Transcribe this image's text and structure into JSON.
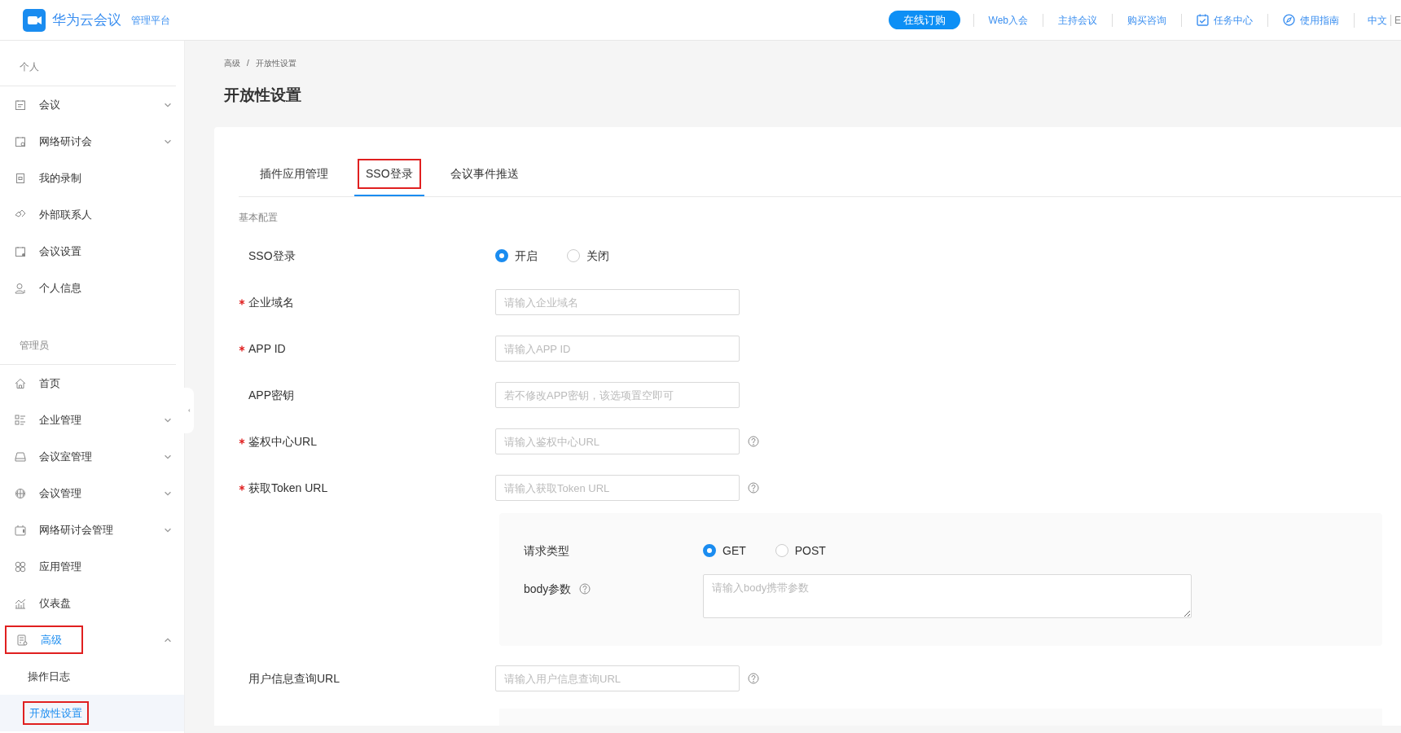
{
  "header": {
    "logo_text": "华为云会议",
    "sub_text": "管理平台",
    "buy_button": "在线订购",
    "links": [
      {
        "label": "Web入会",
        "kind": "text"
      },
      {
        "label": "主持会议",
        "kind": "text"
      },
      {
        "label": "购买咨询",
        "kind": "text"
      },
      {
        "label": "任务中心",
        "kind": "task"
      },
      {
        "label": "使用指南",
        "kind": "guide"
      }
    ],
    "languages": [
      {
        "label": "中文",
        "selected": true
      },
      {
        "label": "E",
        "selected": false
      }
    ]
  },
  "sidebar": {
    "sections": [
      {
        "title": "个人",
        "items": [
          {
            "label": "会议",
            "kind": "group",
            "expanded": false,
            "selected": false,
            "highlighted": false
          },
          {
            "label": "网络研讨会",
            "kind": "group",
            "expanded": false,
            "selected": false,
            "highlighted": false
          },
          {
            "label": "我的录制",
            "kind": "link",
            "selected": false,
            "highlighted": false
          },
          {
            "label": "外部联系人",
            "kind": "link",
            "selected": false,
            "highlighted": false
          },
          {
            "label": "会议设置",
            "kind": "link",
            "selected": false,
            "highlighted": false
          },
          {
            "label": "个人信息",
            "kind": "link",
            "selected": false,
            "highlighted": false
          }
        ]
      },
      {
        "title": "管理员",
        "items": [
          {
            "label": "首页",
            "kind": "link",
            "selected": false,
            "highlighted": false
          },
          {
            "label": "企业管理",
            "kind": "group",
            "expanded": false,
            "selected": false,
            "highlighted": false
          },
          {
            "label": "会议室管理",
            "kind": "group",
            "expanded": false,
            "selected": false,
            "highlighted": false
          },
          {
            "label": "会议管理",
            "kind": "group",
            "expanded": false,
            "selected": false,
            "highlighted": false
          },
          {
            "label": "网络研讨会管理",
            "kind": "group",
            "expanded": false,
            "selected": false,
            "highlighted": false
          },
          {
            "label": "应用管理",
            "kind": "link",
            "selected": false,
            "highlighted": false
          },
          {
            "label": "仪表盘",
            "kind": "link",
            "selected": false,
            "highlighted": false
          },
          {
            "label": "高级",
            "kind": "group",
            "expanded": true,
            "selected": true,
            "highlighted": true,
            "children": [
              {
                "label": "操作日志",
                "selected": false,
                "highlighted": false
              },
              {
                "label": "开放性设置",
                "selected": true,
                "highlighted": true
              }
            ]
          }
        ]
      }
    ]
  },
  "breadcrumb": {
    "items": [
      "高级",
      "开放性设置"
    ],
    "separator": "/"
  },
  "page_title": "开放性设置",
  "tabs": [
    {
      "label": "插件应用管理",
      "selected": false,
      "highlighted": false
    },
    {
      "label": "SSO登录",
      "selected": true,
      "highlighted": true
    },
    {
      "label": "会议事件推送",
      "selected": false,
      "highlighted": false
    }
  ],
  "form": {
    "section_title": "基本配置",
    "rows": [
      {
        "kind": "radio",
        "label": "SSO登录",
        "required": false,
        "options": [
          {
            "label": "开启",
            "selected": true
          },
          {
            "label": "关闭",
            "selected": false
          }
        ]
      },
      {
        "kind": "input",
        "label": "企业域名",
        "required": true,
        "placeholder": "请输入企业域名",
        "help": false
      },
      {
        "kind": "input",
        "label": "APP ID",
        "required": true,
        "placeholder": "请输入APP ID",
        "help": false
      },
      {
        "kind": "input",
        "label": "APP密钥",
        "required": false,
        "placeholder": "若不修改APP密钥，该选项置空即可",
        "help": false
      },
      {
        "kind": "input",
        "label": "鉴权中心URL",
        "required": true,
        "placeholder": "请输入鉴权中心URL",
        "help": true
      },
      {
        "kind": "input",
        "label": "获取Token URL",
        "required": true,
        "placeholder": "请输入获取Token URL",
        "help": true
      },
      {
        "kind": "panel",
        "rows": [
          {
            "kind": "radio",
            "label": "请求类型",
            "label_help": false,
            "options": [
              {
                "label": "GET",
                "selected": true
              },
              {
                "label": "POST",
                "selected": false
              }
            ]
          },
          {
            "kind": "textarea",
            "label": "body参数",
            "label_help": true,
            "placeholder": "请输入body携带参数"
          }
        ]
      },
      {
        "kind": "input",
        "label": "用户信息查询URL",
        "required": false,
        "placeholder": "请输入用户信息查询URL",
        "help": true
      },
      {
        "kind": "panel"
      }
    ]
  }
}
